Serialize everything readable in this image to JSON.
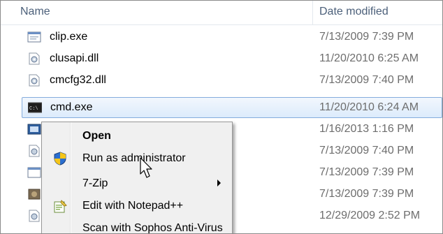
{
  "header": {
    "name_label": "Name",
    "date_label": "Date modified"
  },
  "files": [
    {
      "name": "clip.exe",
      "date": "7/13/2009 7:39 PM",
      "icon": "exe-window-icon"
    },
    {
      "name": "clusapi.dll",
      "date": "11/20/2010 6:25 AM",
      "icon": "dll-gear-icon"
    },
    {
      "name": "cmcfg32.dll",
      "date": "7/13/2009 7:40 PM",
      "icon": "dll-gear-icon"
    },
    {
      "name": "cmd.exe",
      "date": "11/20/2010 6:24 AM",
      "icon": "console-icon"
    },
    {
      "name": "",
      "date": "1/16/2013 1:16 PM",
      "icon": "app-icon"
    },
    {
      "name": "",
      "date": "7/13/2009 7:40 PM",
      "icon": "dll-gear-icon"
    },
    {
      "name": "",
      "date": "7/13/2009 7:39 PM",
      "icon": "exe-window-icon"
    },
    {
      "name": "",
      "date": "7/13/2009 7:39 PM",
      "icon": "app-icon"
    },
    {
      "name": "",
      "date": "12/29/2009 2:52 PM",
      "icon": "dll-gear-icon"
    }
  ],
  "context_menu": {
    "items": [
      {
        "label": "Open",
        "bold": true,
        "icon": ""
      },
      {
        "label": "Run as administrator",
        "bold": false,
        "icon": "uac-shield-icon"
      },
      {
        "label": "7-Zip",
        "bold": false,
        "icon": "",
        "submenu": true
      },
      {
        "label": "Edit with Notepad++",
        "bold": false,
        "icon": "notepad-plus-plus-icon"
      },
      {
        "label": "Scan with Sophos Anti-Virus",
        "bold": false,
        "icon": ""
      }
    ]
  },
  "colors": {
    "selection_fill": "#dcebfc",
    "selection_border": "#84acdd",
    "header_text": "#4c607a",
    "date_text": "#6d6d6d",
    "menu_bg": "#f0f0f0"
  }
}
